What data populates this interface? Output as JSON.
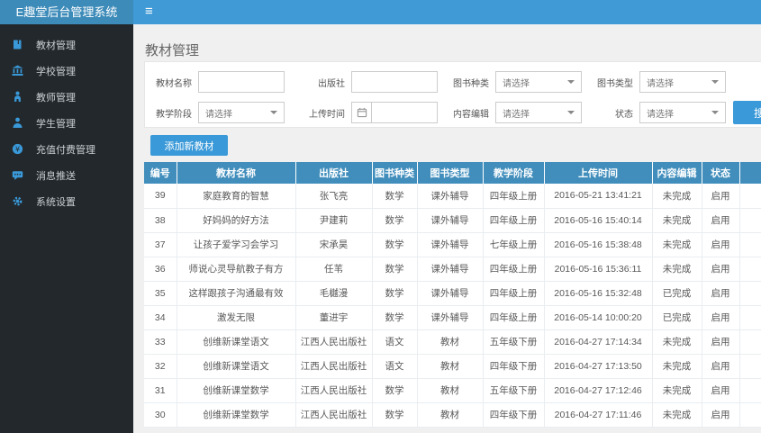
{
  "colors": {
    "topbar": "#3f9ad6",
    "brand_bg": "#3d8bb9",
    "sidebar_bg": "#23282c",
    "accent": "#3a99d8",
    "table_header_bg": "#418ebc",
    "main_bg": "#f0f0f0"
  },
  "topbar": {
    "brand": "E趣堂后台管理系统",
    "menu_icon": "≡"
  },
  "sidebar": {
    "items": [
      {
        "label": "教材管理",
        "icon": "book-icon"
      },
      {
        "label": "学校管理",
        "icon": "school-icon"
      },
      {
        "label": "教师管理",
        "icon": "teacher-icon"
      },
      {
        "label": "学生管理",
        "icon": "student-icon"
      },
      {
        "label": "充值付费管理",
        "icon": "payment-icon"
      },
      {
        "label": "消息推送",
        "icon": "message-icon"
      },
      {
        "label": "系统设置",
        "icon": "settings-icon"
      }
    ]
  },
  "page": {
    "title": "教材管理"
  },
  "filters": {
    "name_label": "教材名称",
    "name_value": "",
    "publisher_label": "出版社",
    "publisher_value": "",
    "category_label": "图书种类",
    "category_value": "请选择",
    "type_label": "图书类型",
    "type_value": "请选择",
    "stage_label": "教学阶段",
    "stage_value": "请选择",
    "upload_label": "上传时间",
    "upload_value": "",
    "editor_label": "内容编辑",
    "editor_value": "请选择",
    "status_label": "状态",
    "status_value": "请选择",
    "search_label": "搜索"
  },
  "toolbar": {
    "add_button": "添加新教材"
  },
  "table": {
    "headers": [
      "编号",
      "教材名称",
      "出版社",
      "图书种类",
      "图书类型",
      "教学阶段",
      "上传时间",
      "内容编辑",
      "状态"
    ],
    "rows": [
      [
        "39",
        "家庭教育的智慧",
        "张飞亮",
        "数学",
        "课外辅导",
        "四年级上册",
        "2016-05-21 13:41:21",
        "未完成",
        "启用"
      ],
      [
        "38",
        "好妈妈的好方法",
        "尹建莉",
        "数学",
        "课外辅导",
        "四年级上册",
        "2016-05-16 15:40:14",
        "未完成",
        "启用"
      ],
      [
        "37",
        "让孩子爱学习会学习",
        "宋承昊",
        "数学",
        "课外辅导",
        "七年级上册",
        "2016-05-16 15:38:48",
        "未完成",
        "启用"
      ],
      [
        "36",
        "师说心灵导航教子有方",
        "任苇",
        "数学",
        "课外辅导",
        "四年级上册",
        "2016-05-16 15:36:11",
        "未完成",
        "启用"
      ],
      [
        "35",
        "这样跟孩子沟通最有效",
        "毛樾漫",
        "数学",
        "课外辅导",
        "四年级上册",
        "2016-05-16 15:32:48",
        "已完成",
        "启用"
      ],
      [
        "34",
        "激发无限",
        "董进宇",
        "数学",
        "课外辅导",
        "四年级上册",
        "2016-05-14 10:00:20",
        "已完成",
        "启用"
      ],
      [
        "33",
        "创维新课堂语文",
        "江西人民出版社",
        "语文",
        "教材",
        "五年级下册",
        "2016-04-27 17:14:34",
        "未完成",
        "启用"
      ],
      [
        "32",
        "创维新课堂语文",
        "江西人民出版社",
        "语文",
        "教材",
        "四年级下册",
        "2016-04-27 17:13:50",
        "未完成",
        "启用"
      ],
      [
        "31",
        "创维新课堂数学",
        "江西人民出版社",
        "数学",
        "教材",
        "五年级下册",
        "2016-04-27 17:12:46",
        "未完成",
        "启用"
      ],
      [
        "30",
        "创维新课堂数学",
        "江西人民出版社",
        "数学",
        "教材",
        "四年级下册",
        "2016-04-27 17:11:46",
        "未完成",
        "启用"
      ]
    ]
  }
}
